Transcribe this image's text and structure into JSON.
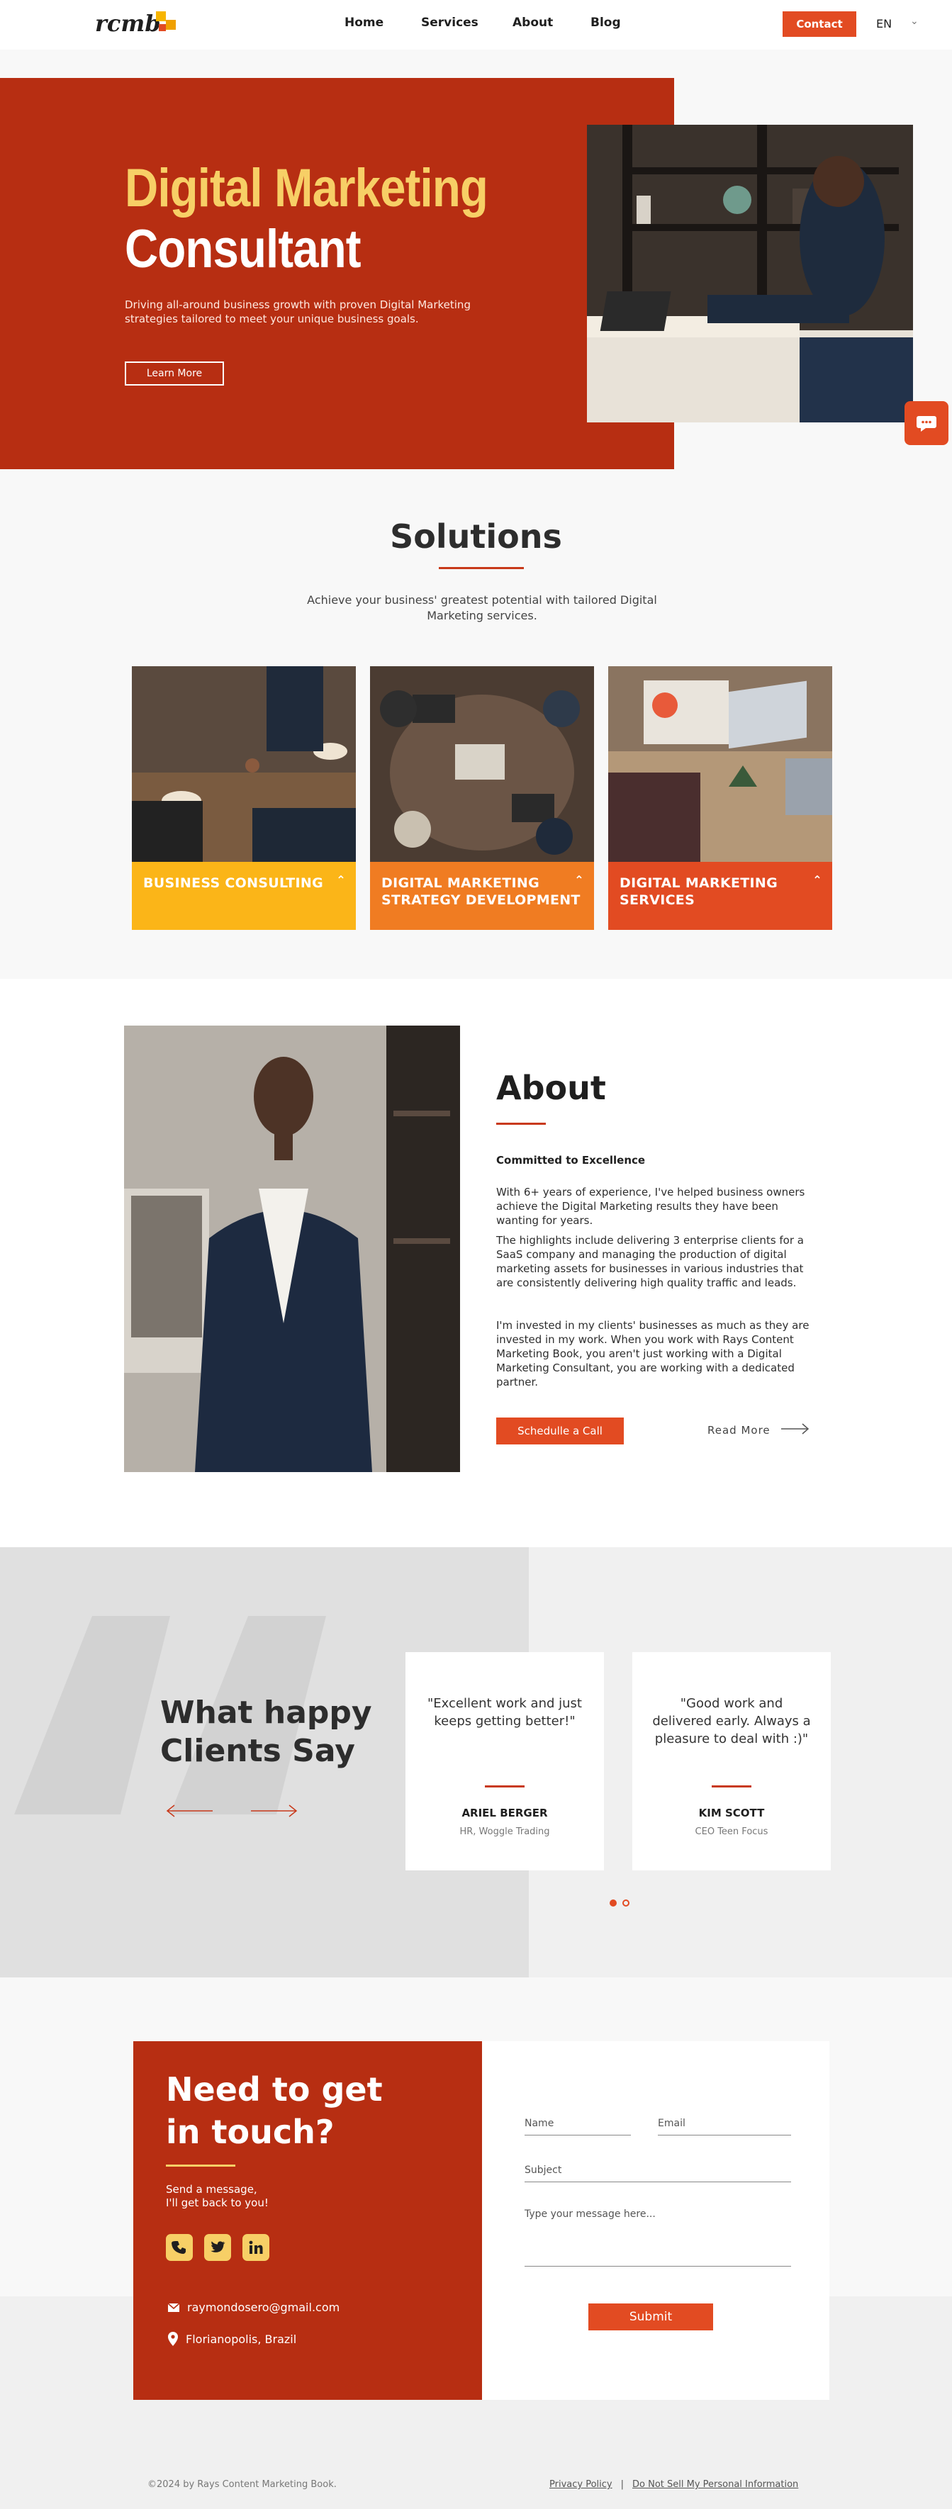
{
  "header": {
    "logo_text": "rcmb",
    "nav": [
      "Home",
      "Services",
      "About",
      "Blog"
    ],
    "contact_label": "Contact",
    "language": "EN"
  },
  "hero": {
    "title_line1": "Digital Marketing",
    "title_line2": "Consultant",
    "description": "Driving all-around business growth with proven Digital Marketing strategies tailored to meet your unique business goals.",
    "cta": "Learn More"
  },
  "solutions": {
    "title": "Solutions",
    "description": "Achieve your business' greatest potential with tailored Digital Marketing services.",
    "cards": [
      {
        "label": "BUSINESS CONSULTING",
        "color": "#fbb518"
      },
      {
        "label": "DIGITAL MARKETING STRATEGY DEVELOPMENT",
        "color": "#f07c22"
      },
      {
        "label": "DIGITAL MARKETING SERVICES",
        "color": "#e24b22"
      }
    ]
  },
  "about": {
    "title": "About",
    "subtitle": "Committed to Excellence",
    "paragraphs": [
      "With 6+ years of experience, I've helped business owners achieve the Digital Marketing results they have been wanting for years.",
      "The highlights include delivering 3 enterprise clients for a SaaS company and managing the production of digital marketing assets for businesses in various industries that are consistently delivering high quality traffic and leads.",
      "I'm invested in my clients' businesses as much as they are invested in my work. When you work with Rays Content Marketing Book, you aren't just working with a Digital Marketing Consultant, you are working with a dedicated partner."
    ],
    "schedule_label": "Schedulle a Call",
    "read_more_label": "Read More"
  },
  "testimonials": {
    "title_line1": "What happy",
    "title_line2": "Clients Say",
    "items": [
      {
        "quote": "\"Excellent work and just keeps getting better!\"",
        "name": "ARIEL BERGER",
        "role": "HR, Woggle Trading"
      },
      {
        "quote": "\"Good work and delivered early. Always a pleasure to deal with :)\"",
        "name": "KIM SCOTT",
        "role": "CEO Teen Focus"
      }
    ]
  },
  "contact": {
    "title_line1": "Need to get",
    "title_line2": "in touch?",
    "sub_line1": "Send a message,",
    "sub_line2": "I'll get back to you!",
    "email": "raymondosero@gmail.com",
    "location": "Florianopolis, Brazil",
    "form": {
      "name_placeholder": "Name",
      "email_placeholder": "Email",
      "subject_placeholder": "Subject",
      "message_placeholder": "Type your message here...",
      "submit_label": "Submit"
    }
  },
  "footer": {
    "copyright": "©2024 by Rays Content Marketing Book.",
    "privacy": "Privacy Policy",
    "separator": "|",
    "do_not_sell": "Do Not Sell My Personal Information"
  },
  "colors": {
    "brand_red": "#b72e12",
    "accent_orange": "#e24b22",
    "accent_yellow": "#f7cf66"
  }
}
